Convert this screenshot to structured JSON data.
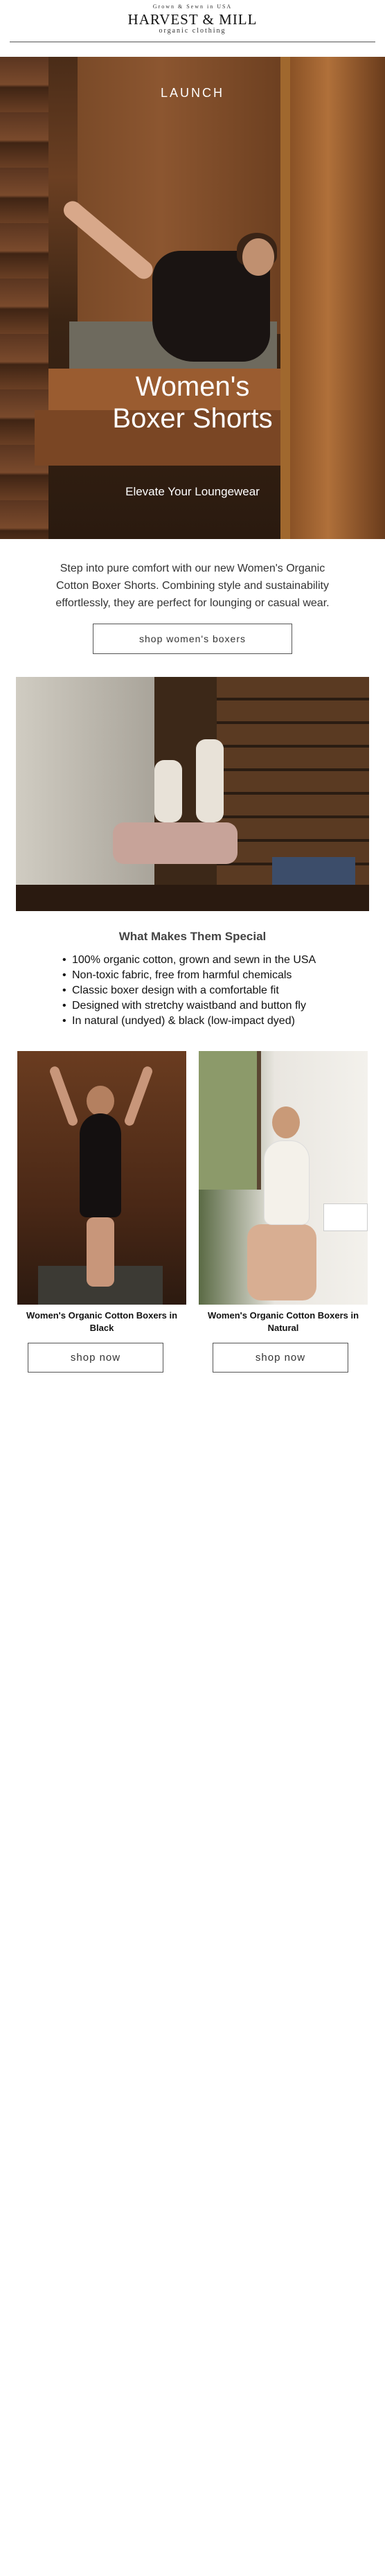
{
  "header": {
    "tagline": "Grown & Sewn in USA",
    "brand": "HARVEST & MILL",
    "brand_sub": "organic clothing"
  },
  "hero": {
    "eyebrow": "LAUNCH",
    "title_line1": "Women's",
    "title_line2": "Boxer Shorts",
    "subtitle": "Elevate Your Loungewear"
  },
  "intro": {
    "text": "Step into pure comfort with our new Women's Organic Cotton Boxer Shorts. Combining style and sustainability effortlessly, they are perfect for lounging or casual wear.",
    "cta": "shop women's boxers"
  },
  "features": {
    "title": "What Makes Them Special",
    "items": [
      "100% organic cotton, grown and sewn in the USA",
      "Non-toxic fabric, free from harmful chemicals",
      "Classic boxer design with a comfortable fit",
      "Designed with stretchy waistband and button fly",
      "In natural (undyed) & black (low-impact dyed)"
    ]
  },
  "products": [
    {
      "name": "Women's Organic Cotton Boxers in Black",
      "cta": "shop now"
    },
    {
      "name": "Women's Organic Cotton Boxers in Natural",
      "cta": "shop now"
    }
  ]
}
